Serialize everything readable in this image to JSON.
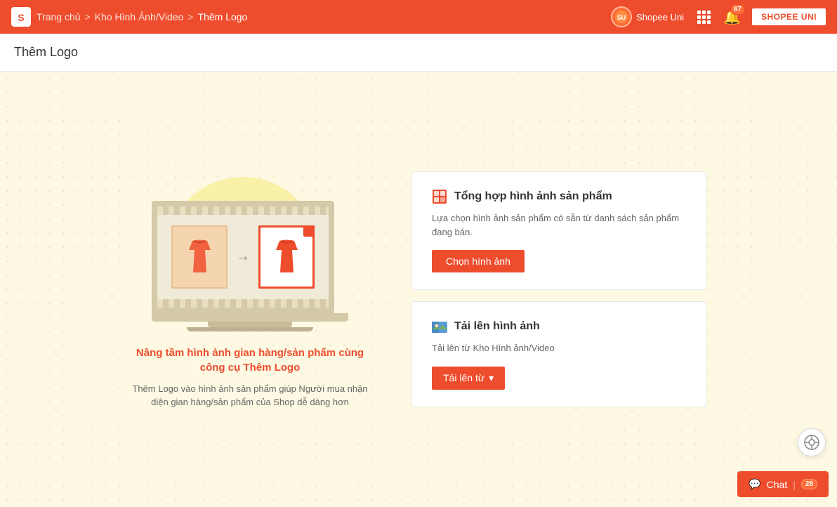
{
  "nav": {
    "breadcrumb_home": "Trang chủ",
    "breadcrumb_sep1": ">",
    "breadcrumb_kho": "Kho Hình Ảnh/Video",
    "breadcrumb_sep2": ">",
    "breadcrumb_current": "Thêm Logo",
    "shopee_uni_label": "Shopee Uni",
    "notification_count": "67",
    "shopee_uni_btn": "SHOPEE UNI"
  },
  "page": {
    "title": "Thêm Logo"
  },
  "option1": {
    "title": "Tổng hợp hình ảnh sản phẩm",
    "description": "Lựa chọn hình ảnh sản phẩm có sẵn từ danh sách sản phẩm đang bán.",
    "btn_label": "Chọn hình ảnh"
  },
  "option2": {
    "title": "Tải lên hình ảnh",
    "description": "Tải lên từ Kho Hình ảnh/Video",
    "btn_label": "Tải lên từ"
  },
  "illustration": {
    "title": "Nâng tầm hình ảnh gian hàng/sản phẩm cùng công cụ Thêm Logo",
    "description": "Thêm Logo vào hình ảnh sản phẩm giúp Người mua nhận diện gian hàng/sản phẩm của Shop dễ dàng hơn"
  },
  "support": {
    "icon": "⚙"
  },
  "chat": {
    "label": "Chat",
    "badge": "28"
  }
}
